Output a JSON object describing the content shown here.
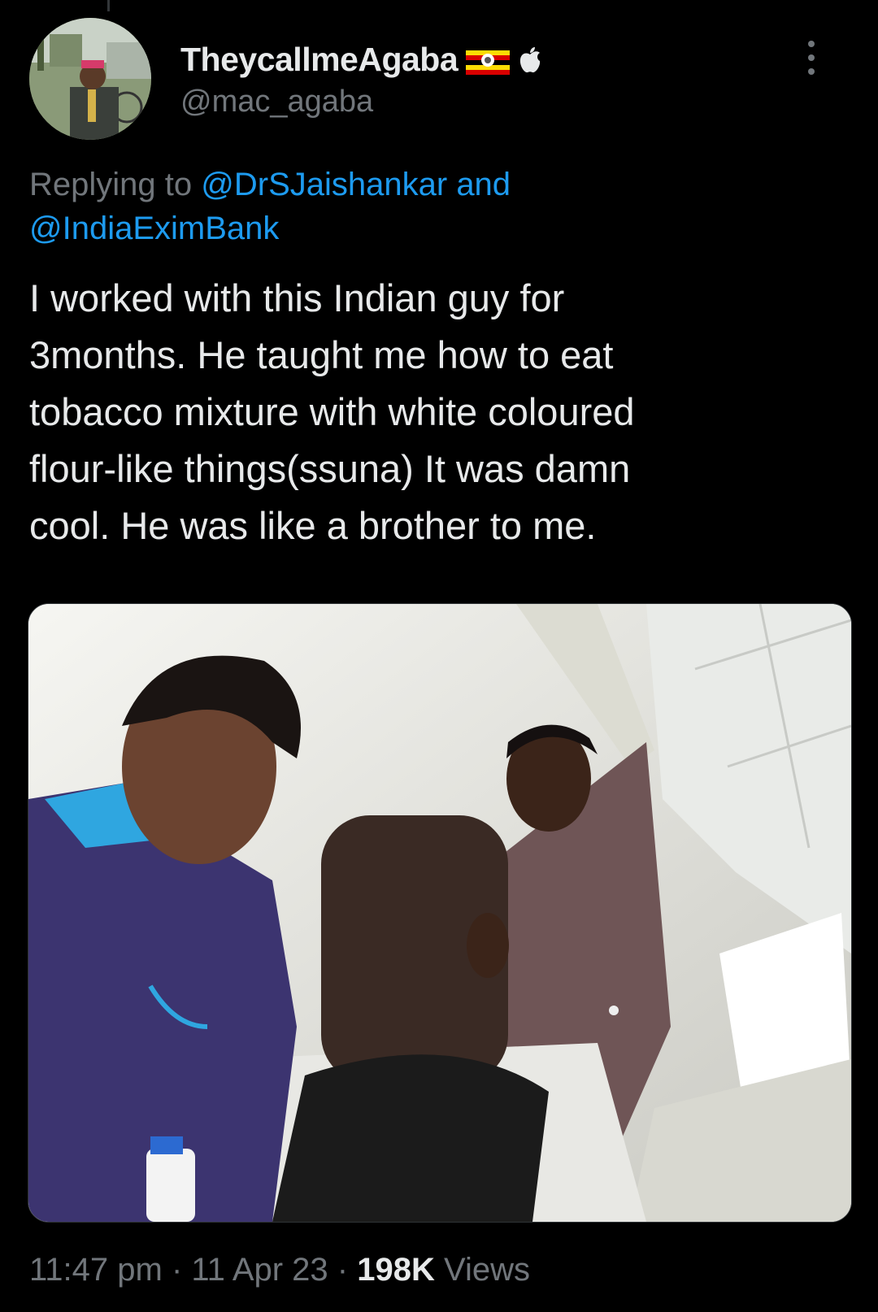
{
  "tweet": {
    "author": {
      "display_name": "TheycallmeAgaba",
      "handle": "@mac_agaba",
      "badges": [
        "uganda-flag-icon",
        "apple-icon"
      ]
    },
    "replying": {
      "prefix": "Replying to",
      "mention_1": "@DrSJaishankar",
      "conjunction": "and",
      "mention_2": "@IndiaEximBank"
    },
    "text": "I worked with this Indian guy for\n3months. He taught me how to eat\ntobacco mixture with white coloured\nflour-like things(ssuna) It was damn\ncool. He was like a brother to me.",
    "meta": {
      "time": "11:47 pm",
      "sep1": "·",
      "date": "11 Apr 23",
      "sep2": "·",
      "views_count": "198K",
      "views_label": "Views"
    }
  },
  "colors": {
    "background": "#000000",
    "text_primary": "#e7e9ea",
    "text_secondary": "#71767b",
    "link": "#1d9bf0"
  }
}
